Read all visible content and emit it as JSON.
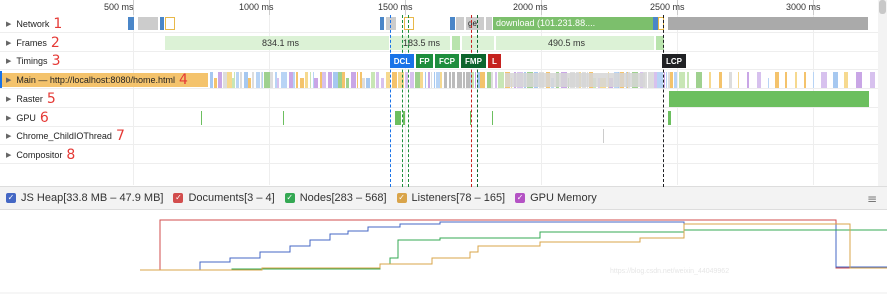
{
  "ruler": {
    "ticks": [
      {
        "label": "500 ms",
        "ms": 500
      },
      {
        "label": "1000 ms",
        "ms": 1000
      },
      {
        "label": "1500 ms",
        "ms": 1500
      },
      {
        "label": "2000 ms",
        "ms": 2000
      },
      {
        "label": "2500 ms",
        "ms": 2500
      },
      {
        "label": "3000 ms",
        "ms": 3000
      }
    ]
  },
  "tracks": [
    {
      "name": "Network",
      "annotation": "1"
    },
    {
      "name": "Frames",
      "annotation": "2"
    },
    {
      "name": "Timings",
      "annotation": "3"
    },
    {
      "name": "Main — http://localhost:8080/home.html",
      "annotation": "4"
    },
    {
      "name": "Raster",
      "annotation": "5"
    },
    {
      "name": "GPU",
      "annotation": "6"
    },
    {
      "name": "Chrome_ChildIOThread",
      "annotation": "7"
    },
    {
      "name": "Compositor",
      "annotation": "8"
    }
  ],
  "network": {
    "request_ge": "ge",
    "request_download": "download (101.231.88...."
  },
  "frames": {
    "f1": "834.1 ms",
    "f2": "183.5 ms",
    "f3": "490.5 ms"
  },
  "timings": {
    "markers": [
      "DCL",
      "FP",
      "FCP",
      "FMP",
      "L",
      "LCP"
    ],
    "colors": {
      "DCL": "#1a73e8",
      "FP": "#1e8e3e",
      "FCP": "#1e8e3e",
      "FMP": "#0d652d",
      "L": "#c5221f",
      "LCP": "#202124"
    }
  },
  "memory": {
    "legend": [
      {
        "label": "JS Heap[33.8 MB – 47.9 MB]",
        "color": "#4467c4",
        "checked": true
      },
      {
        "label": "Documents[3 – 4]",
        "color": "#d24d4d",
        "checked": true
      },
      {
        "label": "Nodes[283 – 568]",
        "color": "#34a853",
        "checked": true
      },
      {
        "label": "Listeners[78 – 165]",
        "color": "#d9a44a",
        "checked": true
      },
      {
        "label": "GPU Memory",
        "color": "#b452c4",
        "checked": true
      }
    ],
    "menu_icon": "hamburger-icon",
    "watermark": "https://blog.csdn.net/weixin_44049962"
  }
}
